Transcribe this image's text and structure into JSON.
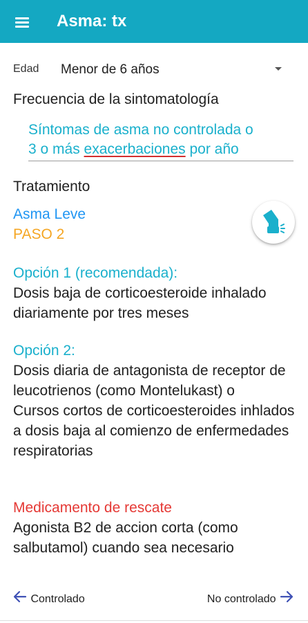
{
  "app_bar": {
    "title": "Asma: tx",
    "menu_icon": "hamburger-menu-icon"
  },
  "age": {
    "label": "Edad",
    "value": "Menor de 6 años"
  },
  "frequency": {
    "label": "Frecuencia de la sintomatología",
    "value_line1": "Síntomas de asma no controlada o",
    "value_line2_prefix": "3 o más ",
    "value_line2_flagged": "exacerbaciones",
    "value_line2_suffix": " por año"
  },
  "treatment": {
    "label": "Tratamiento",
    "severity": "Asma Leve",
    "step": "PASO 2",
    "inhaler_icon": "inhaler-icon",
    "option1_title": "Opción 1 (recomendada):",
    "option1_text": "Dosis baja de corticoesteroide inhalado diariamente por tres meses",
    "option2_title": "Opción 2:",
    "option2_text_a": "Dosis diaria de antagonista de receptor de leucotrienos (como Montelukast) o",
    "option2_text_b": "Cursos cortos de corticoesteroides inhlados a dosis baja al comienzo de enfermedades respiratorias",
    "rescue_title": "Medicamento de rescate",
    "rescue_text": "Agonista B2 de accion corta (como salbutamol) cuando sea necesario"
  },
  "navigation": {
    "prev_label": "Controlado",
    "next_label": "No controlado"
  },
  "colors": {
    "app_bar": "#14a8c2",
    "link_blue": "#1ab0cc",
    "severity_blue": "#2196f3",
    "step_orange": "#f5a623",
    "rescue_red": "#e53935",
    "nav_arrow": "#3f51b5"
  }
}
